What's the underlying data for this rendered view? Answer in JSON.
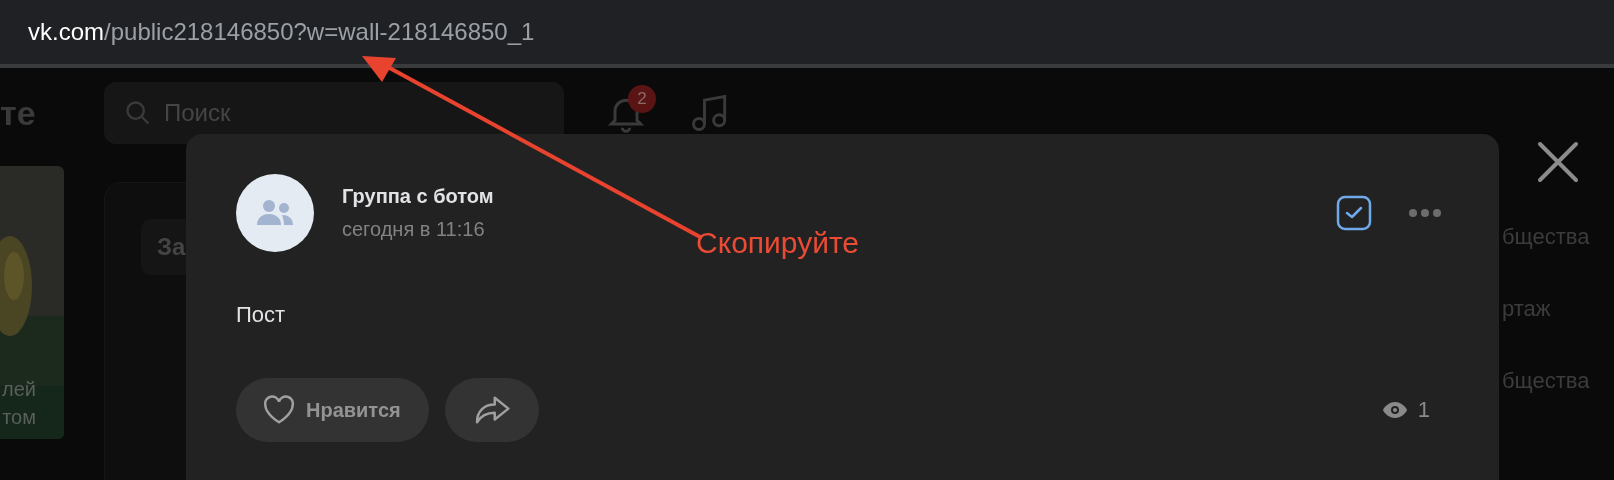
{
  "browser": {
    "url_domain": "vk.com",
    "url_path": "/public218146850?w=wall-218146850_1"
  },
  "background_page": {
    "logo_fragment": "те",
    "search": {
      "placeholder": "Поиск"
    },
    "notifications_badge": "2",
    "left_card_text": [
      "лей",
      "том"
    ],
    "button_fragment": "За",
    "right_menu": [
      "бщества",
      "ртаж",
      "бщества"
    ]
  },
  "post_modal": {
    "group_name": "Группа с ботом",
    "time": "сегодня в 11:16",
    "checked": true,
    "text": "Пост",
    "like_button": "Нравится",
    "views": "1"
  },
  "annotation": {
    "text": "Скопируйте"
  }
}
